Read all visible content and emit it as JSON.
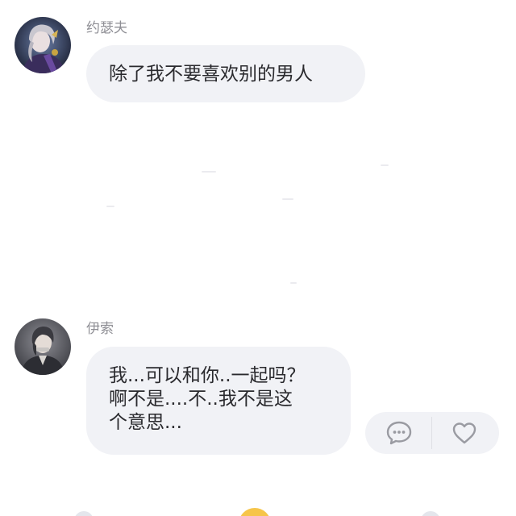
{
  "messages": [
    {
      "sender": "约瑟夫",
      "avatar": "joseph-portrait-avatar",
      "text": "除了我不要喜欢别的男人"
    },
    {
      "sender": "伊索",
      "avatar": "aesop-portrait-avatar",
      "lines": [
        "我...可以和你..一起吗？",
        "啊不是....不..我不是这",
        "个意思..."
      ]
    }
  ],
  "actions": {
    "comment_icon": "comment-bubble-icon",
    "like_icon": "heart-outline-icon"
  },
  "colors": {
    "bubble_bg": "#f1f2f6",
    "text": "#2a2a2e",
    "name_text": "#8f8f95",
    "icon_gray": "#9a9ba2",
    "nav_accent": "#f6c54a"
  }
}
